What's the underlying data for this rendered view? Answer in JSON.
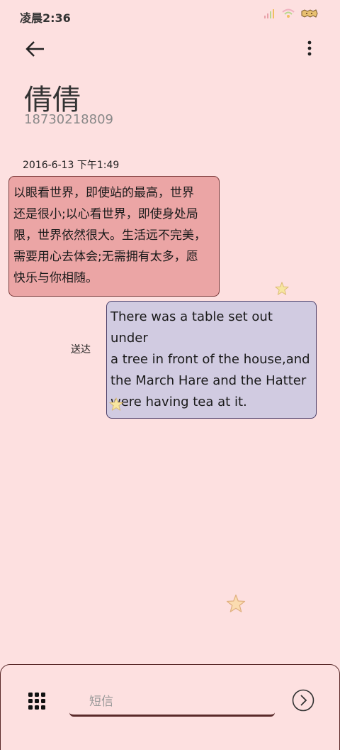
{
  "status_bar": {
    "time": "凌晨2:36",
    "icons": [
      "signal-icon",
      "wifi-icon",
      "battery-icon"
    ]
  },
  "header": {
    "back_icon": "arrow-left-icon",
    "more_icon": "more-vertical-icon",
    "contact_name": "倩倩",
    "contact_number": "18730218809"
  },
  "conversation": {
    "timestamp": "2016-6-13 下午1:49",
    "incoming_message": {
      "lines": [
        "以眼看世界，即使站的最高，世界",
        "还是很小;以心看世界，即使身处局",
        "限，世界依然很大。生活远不完美，",
        "需要用心去体会;无需拥有太多，愿",
        "快乐与你相随。"
      ]
    },
    "outgoing_message": {
      "lines": [
        "There was a table set out under",
        "a tree in front of the house,and",
        "the March Hare and the Hatter",
        "were having tea at it."
      ],
      "status": "送达"
    }
  },
  "compose": {
    "placeholder": "短信",
    "value": "",
    "grid_icon": "grid-icon",
    "send_icon": "send-arrow-icon"
  },
  "colors": {
    "background": "#fde0e0",
    "incoming_bubble": "#eba5a5",
    "outgoing_bubble": "#d1cbe1",
    "accent": "#5a2a2a"
  }
}
